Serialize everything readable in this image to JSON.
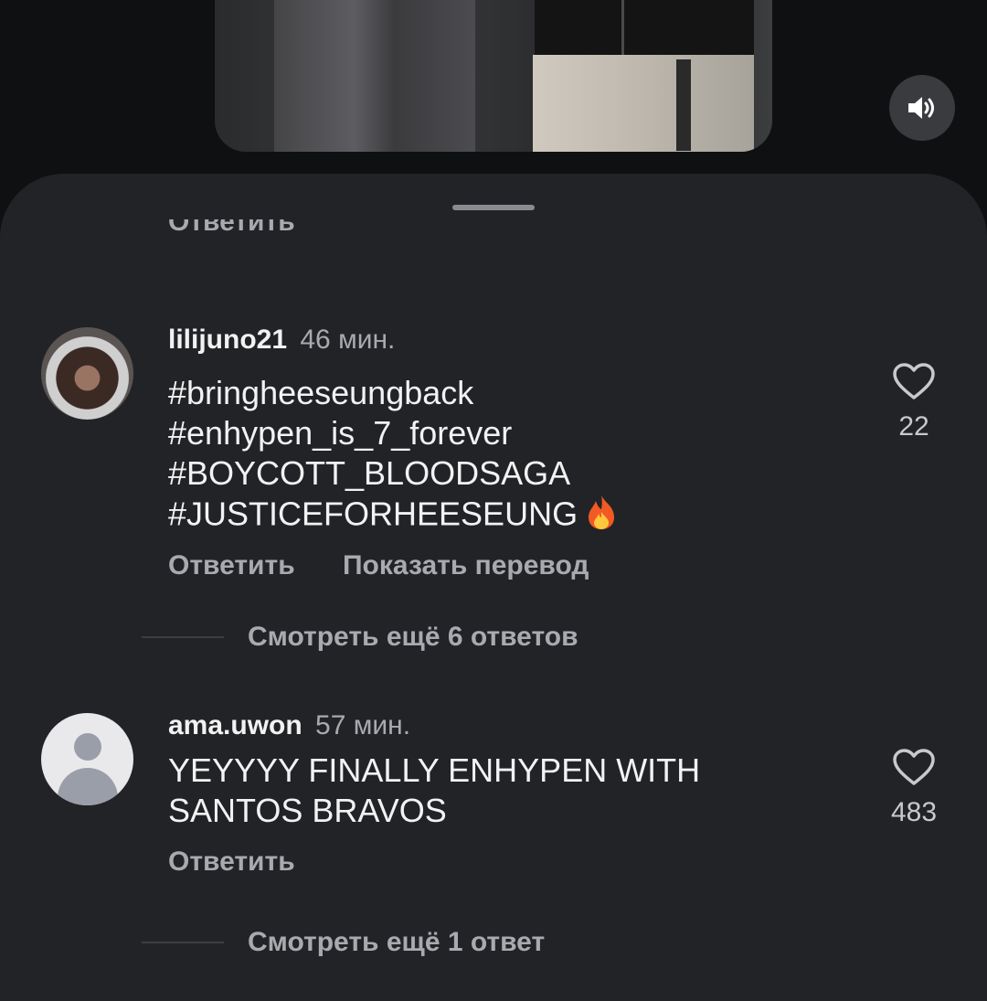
{
  "video": {
    "sound_icon": "speaker-icon"
  },
  "sheet": {
    "cut_off_reply": "Ответить"
  },
  "comments": [
    {
      "username": "lilijuno21",
      "time": "46 мин.",
      "lines": [
        "#bringheeseungback",
        "#enhypen_is_7_forever",
        "#BOYCOTT_BLOODSAGA",
        "#JUSTICEFORHEESEUNG"
      ],
      "emoji": "fire",
      "likes": "22",
      "reply_label": "Ответить",
      "translate_label": "Показать перевод",
      "more_replies": "Смотреть ещё 6 ответов"
    },
    {
      "username": "ama.uwon",
      "time": "57 мин.",
      "lines": [
        "YEYYYY FINALLY ENHYPEN WITH",
        "SANTOS BRAVOS"
      ],
      "likes": "483",
      "reply_label": "Ответить",
      "more_replies": "Смотреть ещё 1 ответ"
    }
  ]
}
